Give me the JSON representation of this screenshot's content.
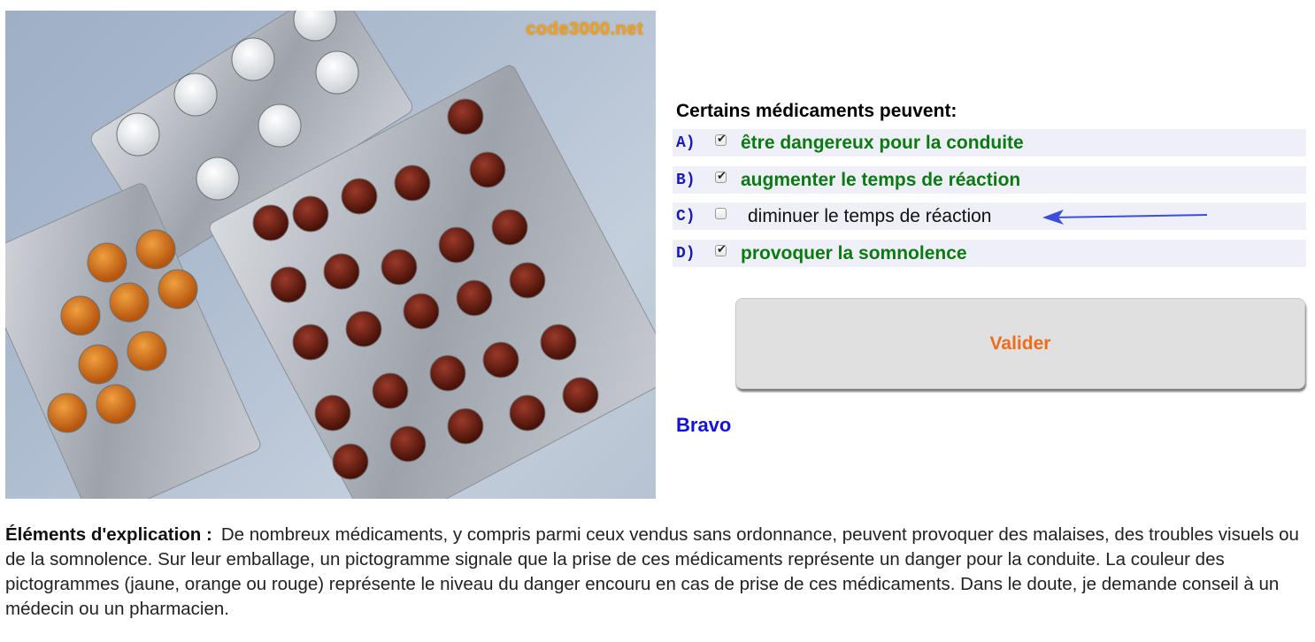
{
  "image": {
    "watermark": "code3000.net",
    "alt_subject": "pill-blister-packs"
  },
  "question": {
    "text": "Certains médicaments peuvent:"
  },
  "options": [
    {
      "letter": "A)",
      "text": "être dangereux pour la conduite",
      "checked": true,
      "correct": true
    },
    {
      "letter": "B)",
      "text": "augmenter le temps de réaction",
      "checked": true,
      "correct": true
    },
    {
      "letter": "C)",
      "text": "diminuer le temps de réaction",
      "checked": false,
      "correct": false
    },
    {
      "letter": "D)",
      "text": "provoquer la somnolence",
      "checked": true,
      "correct": true
    }
  ],
  "button": {
    "label": "Valider"
  },
  "feedback": {
    "text": "Bravo"
  },
  "explanation": {
    "label": "Éléments d'explication :",
    "text": "De nombreux médicaments, y compris parmi ceux vendus sans ordonnance, peuvent provoquer des malaises, des troubles visuels ou de la somnolence. Sur leur emballage, un pictogramme signale que la prise de ces médicaments représente un danger pour la conduite. La couleur des pictogrammes (jaune, orange ou rouge) représente le niveau du danger encouru en cas de prise de ces médicaments. Dans le doute, je demande conseil à un médecin ou un pharmacien."
  },
  "colors": {
    "correct": "#0b7a12",
    "option_letter": "#1a1ab8",
    "button_text": "#ef6d1a",
    "feedback": "#1212d8",
    "arrow": "#3b4fd8"
  },
  "icons": {
    "pointer": "arrow-left-icon",
    "check": "checkmark-icon"
  }
}
